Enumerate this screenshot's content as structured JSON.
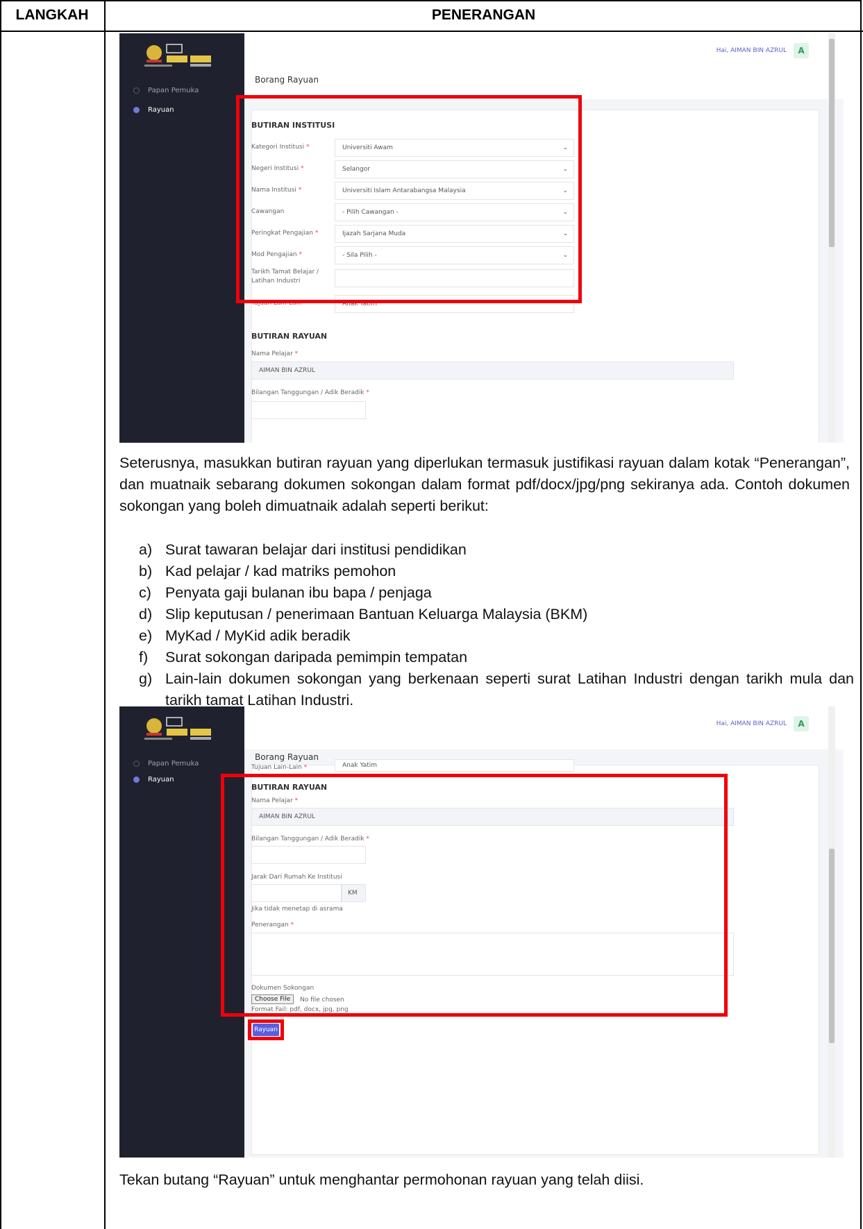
{
  "table": {
    "col1_header": "LANGKAH",
    "col2_header": "PENERANGAN"
  },
  "screenshot1": {
    "greeting": "Hai, AIMAN BIN AZRUL",
    "avatar_letter": "A",
    "sidebar": [
      "Papan Pemuka",
      "Rayuan"
    ],
    "page_title": "Borang Rayuan",
    "section_institusi": "BUTIRAN INSTITUSI",
    "fields": [
      {
        "label": "Kategori Institusi",
        "required": "*",
        "value": "Universiti Awam"
      },
      {
        "label": "Negeri Institusi",
        "required": "*",
        "value": "Selangor"
      },
      {
        "label": "Nama Institusi",
        "required": "*",
        "value": "Universiti Islam Antarabangsa Malaysia"
      },
      {
        "label": "Cawangan",
        "required": "",
        "value": "- Pilih Cawangan -"
      },
      {
        "label": "Peringkat Pengajian",
        "required": "*",
        "value": "Ijazah Sarjana Muda"
      },
      {
        "label": "Mod Pengajian",
        "required": "*",
        "value": "- Sila Pilih -"
      },
      {
        "label": "Tarikh Tamat Belajar / Latihan Industri",
        "required": "",
        "value": ""
      },
      {
        "label": "Tujuan Lain-Lain",
        "required": "*",
        "value": "Anak Yatim"
      }
    ],
    "section_rayuan": "BUTIRAN RAYUAN",
    "nama_pelajar_label": "Nama Pelajar",
    "nama_pelajar_value": "AIMAN BIN AZRUL",
    "bilangan_label": "Bilangan Tanggungan / Adik Beradik"
  },
  "paragraph": "Seterusnya, masukkan butiran rayuan yang diperlukan termasuk justifikasi rayuan dalam kotak “Penerangan”, dan muatnaik sebarang dokumen sokongan dalam format pdf/docx/jpg/png sekiranya ada. Contoh dokumen sokongan yang boleh dimuatnaik adalah seperti berikut:",
  "list": [
    {
      "marker": "a)",
      "text": "Surat tawaran belajar dari institusi pendidikan"
    },
    {
      "marker": "b)",
      "text": "Kad pelajar / kad matriks pemohon"
    },
    {
      "marker": "c)",
      "text": "Penyata gaji bulanan ibu bapa / penjaga"
    },
    {
      "marker": "d)",
      "text": "Slip keputusan / penerimaan Bantuan Keluarga Malaysia (BKM)"
    },
    {
      "marker": "e)",
      "text": "MyKad / MyKid adik beradik"
    },
    {
      "marker": "f)",
      "text": "Surat sokongan daripada pemimpin tempatan"
    },
    {
      "marker": "g)",
      "text": "Lain-lain dokumen sokongan yang berkenaan seperti surat Latihan Industri dengan tarikh mula dan tarikh tamat Latihan Industri."
    }
  ],
  "screenshot2": {
    "greeting": "Hai, AIMAN BIN AZRUL",
    "avatar_letter": "A",
    "sidebar": [
      "Papan Pemuka",
      "Rayuan"
    ],
    "page_title": "Borang Rayuan",
    "partial_label": "Tujuan Lain-Lain",
    "partial_value": "Anak Yatim",
    "section_rayuan": "BUTIRAN RAYUAN",
    "nama_pelajar_label": "Nama Pelajar",
    "nama_pelajar_value": "AIMAN BIN AZRUL",
    "bilangan_label": "Bilangan Tanggungan / Adik Beradik",
    "jarak_label": "Jarak Dari Rumah Ke Institusi",
    "jarak_unit": "KM",
    "jarak_hint": "Jika tidak menetap di asrama",
    "penerangan_label": "Penerangan",
    "dokumen_label": "Dokumen Sokongan",
    "choose_file": "Choose File",
    "no_file": "No file chosen",
    "format_hint": "Format Fail: pdf, docx, jpg, png",
    "submit_label": "Rayuan"
  },
  "closing": "Tekan butang “Rayuan” untuk menghantar permohonan rayuan yang telah diisi.",
  "colors": {
    "highlight": "#f0000a",
    "sidebar": "#1f222e",
    "button": "#5a5fe0"
  }
}
